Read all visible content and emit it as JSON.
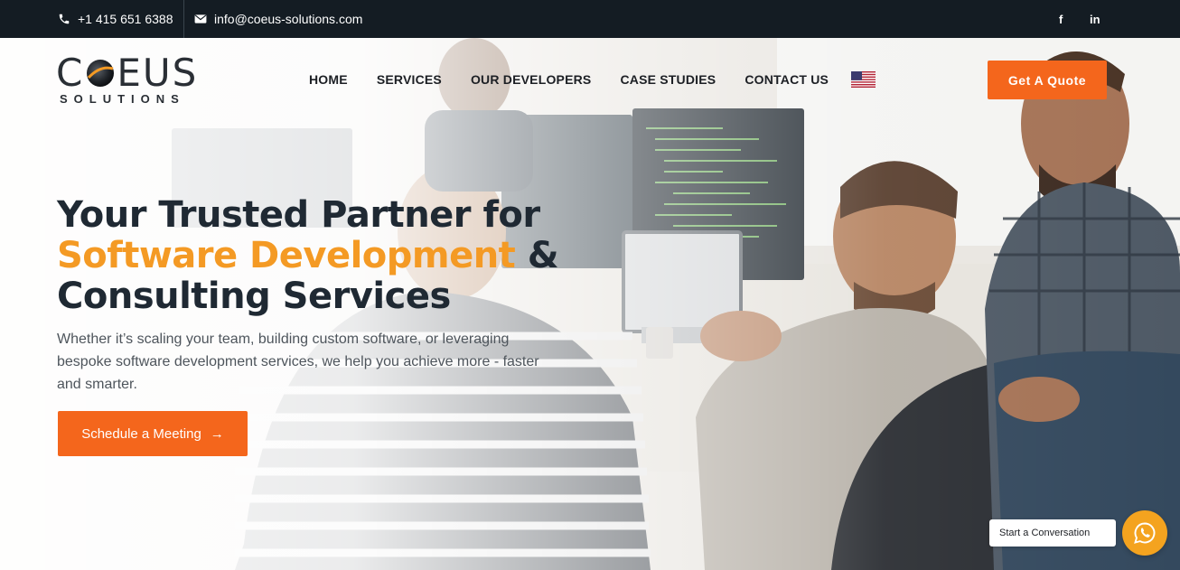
{
  "topbar": {
    "phone": "+1 415 651 6388",
    "email": "info@coeus-solutions.com",
    "social": [
      {
        "label": "f",
        "icon": "facebook-icon"
      },
      {
        "label": "in",
        "icon": "linkedin-icon"
      }
    ]
  },
  "logo": {
    "word_start": "C",
    "word_end": "EUS",
    "sub": "SOLUTIONS"
  },
  "nav": {
    "items": [
      {
        "label": "HOME"
      },
      {
        "label": "SERVICES"
      },
      {
        "label": "OUR DEVELOPERS"
      },
      {
        "label": "CASE STUDIES"
      },
      {
        "label": "CONTACT US"
      }
    ],
    "language_icon": "us-flag-icon",
    "quote_button": "Get A Quote"
  },
  "hero": {
    "line1": "Your Trusted Partner for",
    "line2_highlight": "Software Development",
    "line2_rest": " &",
    "line3": "Consulting Services",
    "subtext": "Whether it’s scaling your team, building custom software, or leveraging bespoke software development services, we help you achieve more - faster and smarter.",
    "cta": "Schedule a Meeting",
    "cta_arrow": "→"
  },
  "chat": {
    "label": "Start a Conversation",
    "icon": "whatsapp-icon"
  },
  "colors": {
    "accent": "#f4661c",
    "highlight": "#f49a24",
    "topbar": "#141c23",
    "chat": "#f4a31f"
  }
}
